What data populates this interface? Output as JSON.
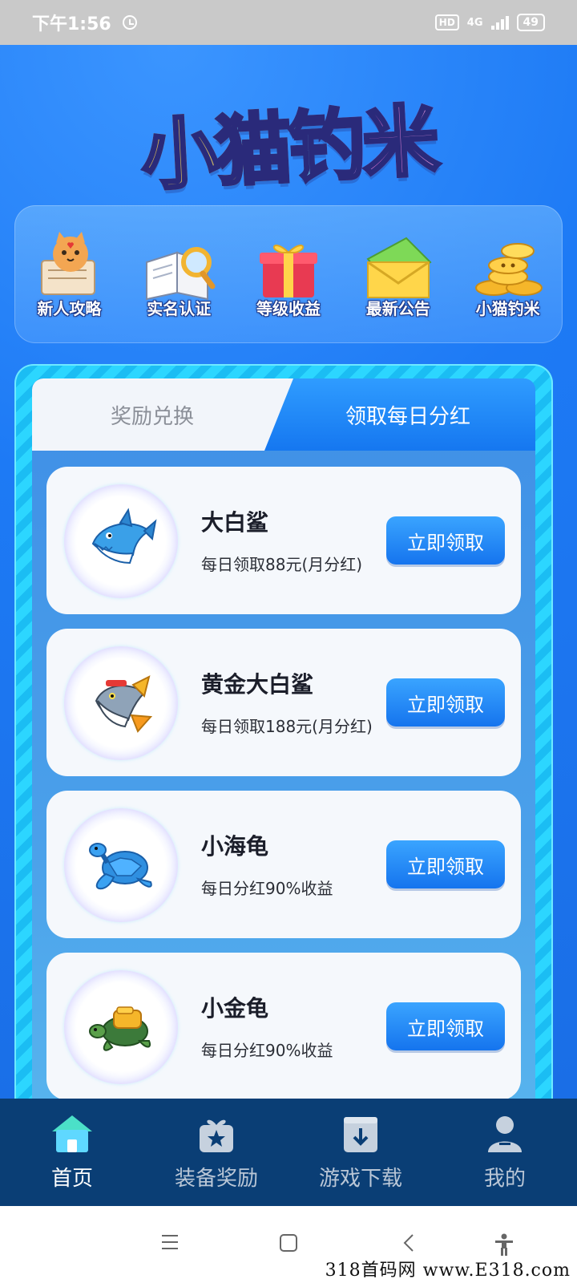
{
  "status_bar": {
    "time": "下午1:56",
    "hd": "HD",
    "network": "4G",
    "battery": "49"
  },
  "logo": {
    "text": "小猫钓米"
  },
  "shortcuts": [
    {
      "label": "新人攻略",
      "icon": "cat-newspaper-icon"
    },
    {
      "label": "实名认证",
      "icon": "book-magnifier-icon"
    },
    {
      "label": "等级收益",
      "icon": "gift-box-icon"
    },
    {
      "label": "最新公告",
      "icon": "envelope-icon"
    },
    {
      "label": "小猫钓米",
      "icon": "gold-coins-icon"
    }
  ],
  "tabs": {
    "exchange": "奖励兑换",
    "dividend": "领取每日分红",
    "active": "dividend"
  },
  "rewards": [
    {
      "name": "大白鲨",
      "desc": "每日领取88元(月分红)",
      "button": "立即领取",
      "icon": "white-shark-icon"
    },
    {
      "name": "黄金大白鲨",
      "desc": "每日领取188元(月分红)",
      "button": "立即领取",
      "icon": "golden-shark-icon"
    },
    {
      "name": "小海龟",
      "desc": "每日分红90%收益",
      "button": "立即领取",
      "icon": "sea-turtle-icon"
    },
    {
      "name": "小金龟",
      "desc": "每日分红90%收益",
      "button": "立即领取",
      "icon": "golden-turtle-icon"
    }
  ],
  "bottom_nav": [
    {
      "label": "首页",
      "icon": "home-icon",
      "active": true
    },
    {
      "label": "装备奖励",
      "icon": "gift-star-icon",
      "active": false
    },
    {
      "label": "游戏下载",
      "icon": "download-box-icon",
      "active": false
    },
    {
      "label": "我的",
      "icon": "user-icon",
      "active": false
    }
  ],
  "watermark": "318首码网 www.E318.com",
  "colors": {
    "primary_blue": "#1d7af5",
    "nav_dark": "#0a3e75",
    "button_blue": "#1574ee"
  }
}
